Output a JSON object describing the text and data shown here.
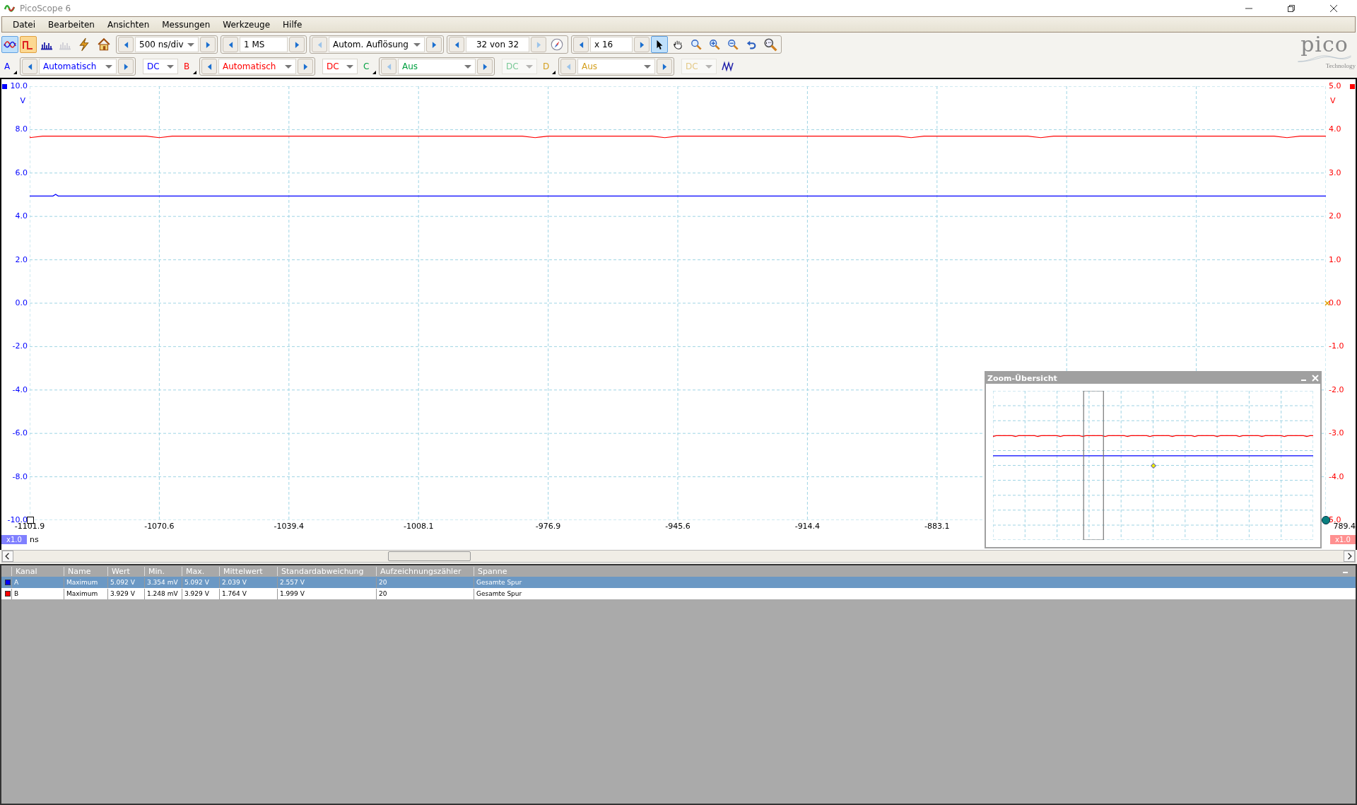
{
  "window": {
    "title": "PicoScope 6"
  },
  "menu": [
    "Datei",
    "Bearbeiten",
    "Ansichten",
    "Messungen",
    "Werkzeuge",
    "Hilfe"
  ],
  "mode_buttons": [
    {
      "kind": "scope",
      "selected": true,
      "disabled": false
    },
    {
      "kind": "persistence",
      "selected": true,
      "disabled": false
    },
    {
      "kind": "spectrum",
      "selected": false,
      "disabled": false
    },
    {
      "kind": "spectrum",
      "selected": false,
      "disabled": true
    }
  ],
  "timebase": {
    "value": "500 ns/div"
  },
  "samples": {
    "value": "1 MS"
  },
  "resolution": {
    "value": "Autom. Auflösung",
    "prev_disabled": true
  },
  "buffer": {
    "value": "32 von 32",
    "next_disabled": true
  },
  "zoom": {
    "value": "x 16"
  },
  "logo": {
    "text": "pico",
    "subtitle": "Technology"
  },
  "tools": [
    {
      "kind": "pointer",
      "selected": true
    },
    {
      "kind": "hand",
      "selected": false
    },
    {
      "kind": "zoom-region",
      "selected": false
    },
    {
      "kind": "zoom-in",
      "selected": false
    },
    {
      "kind": "zoom-out",
      "selected": false
    },
    {
      "kind": "undo",
      "selected": false
    }
  ],
  "channels": [
    {
      "label": "A",
      "color": "#0000ff",
      "range": "Automatisch",
      "coupling": "DC",
      "enabled": true
    },
    {
      "label": "B",
      "color": "#ff0000",
      "range": "Automatisch",
      "coupling": "DC",
      "enabled": true
    },
    {
      "label": "C",
      "color": "#00a040",
      "range": "Aus",
      "coupling": "DC",
      "enabled": false
    },
    {
      "label": "D",
      "color": "#d4a020",
      "range": "Aus",
      "coupling": "DC",
      "enabled": false
    }
  ],
  "plot": {
    "left_axis": {
      "labels": [
        "10.0",
        "8.0",
        "6.0",
        "4.0",
        "2.0",
        "0.0",
        "-2.0",
        "-4.0",
        "-6.0",
        "-8.0",
        "-10.0"
      ],
      "unit": "V"
    },
    "right_axis": {
      "labels": [
        "5.0",
        "4.0",
        "3.0",
        "2.0",
        "1.0",
        "0.0",
        "-1.0",
        "-2.0",
        "-3.0",
        "-4.0",
        "5.0"
      ],
      "unit": "V"
    },
    "time_axis": {
      "labels": [
        "-1101.9",
        "-1070.6",
        "-1039.4",
        "-1008.1",
        "-976.9",
        "-945.6",
        "-914.4",
        "-883.1"
      ],
      "end_label": "789.4",
      "unit": "ns"
    },
    "left_scale": "x1.0",
    "right_scale": "x1.0"
  },
  "overview": {
    "title": "Zoom-Übersicht"
  },
  "table": {
    "columns": [
      "Kanal",
      "Name",
      "Wert",
      "Min.",
      "Max.",
      "Mittelwert",
      "Standardabweichung",
      "Aufzeichnungszähler",
      "Spanne"
    ],
    "rows": [
      {
        "color": "#0000ff",
        "selected": true,
        "cells": [
          "A",
          "Maximum",
          "5.092 V",
          "3.354 mV",
          "5.092 V",
          "2.039 V",
          "2.557 V",
          "20",
          "Gesamte Spur"
        ]
      },
      {
        "color": "#ff0000",
        "selected": false,
        "cells": [
          "B",
          "Maximum",
          "3.929 V",
          "1.248 mV",
          "3.929 V",
          "1.764 V",
          "1.999 V",
          "20",
          "Gesamte Spur"
        ]
      }
    ]
  }
}
